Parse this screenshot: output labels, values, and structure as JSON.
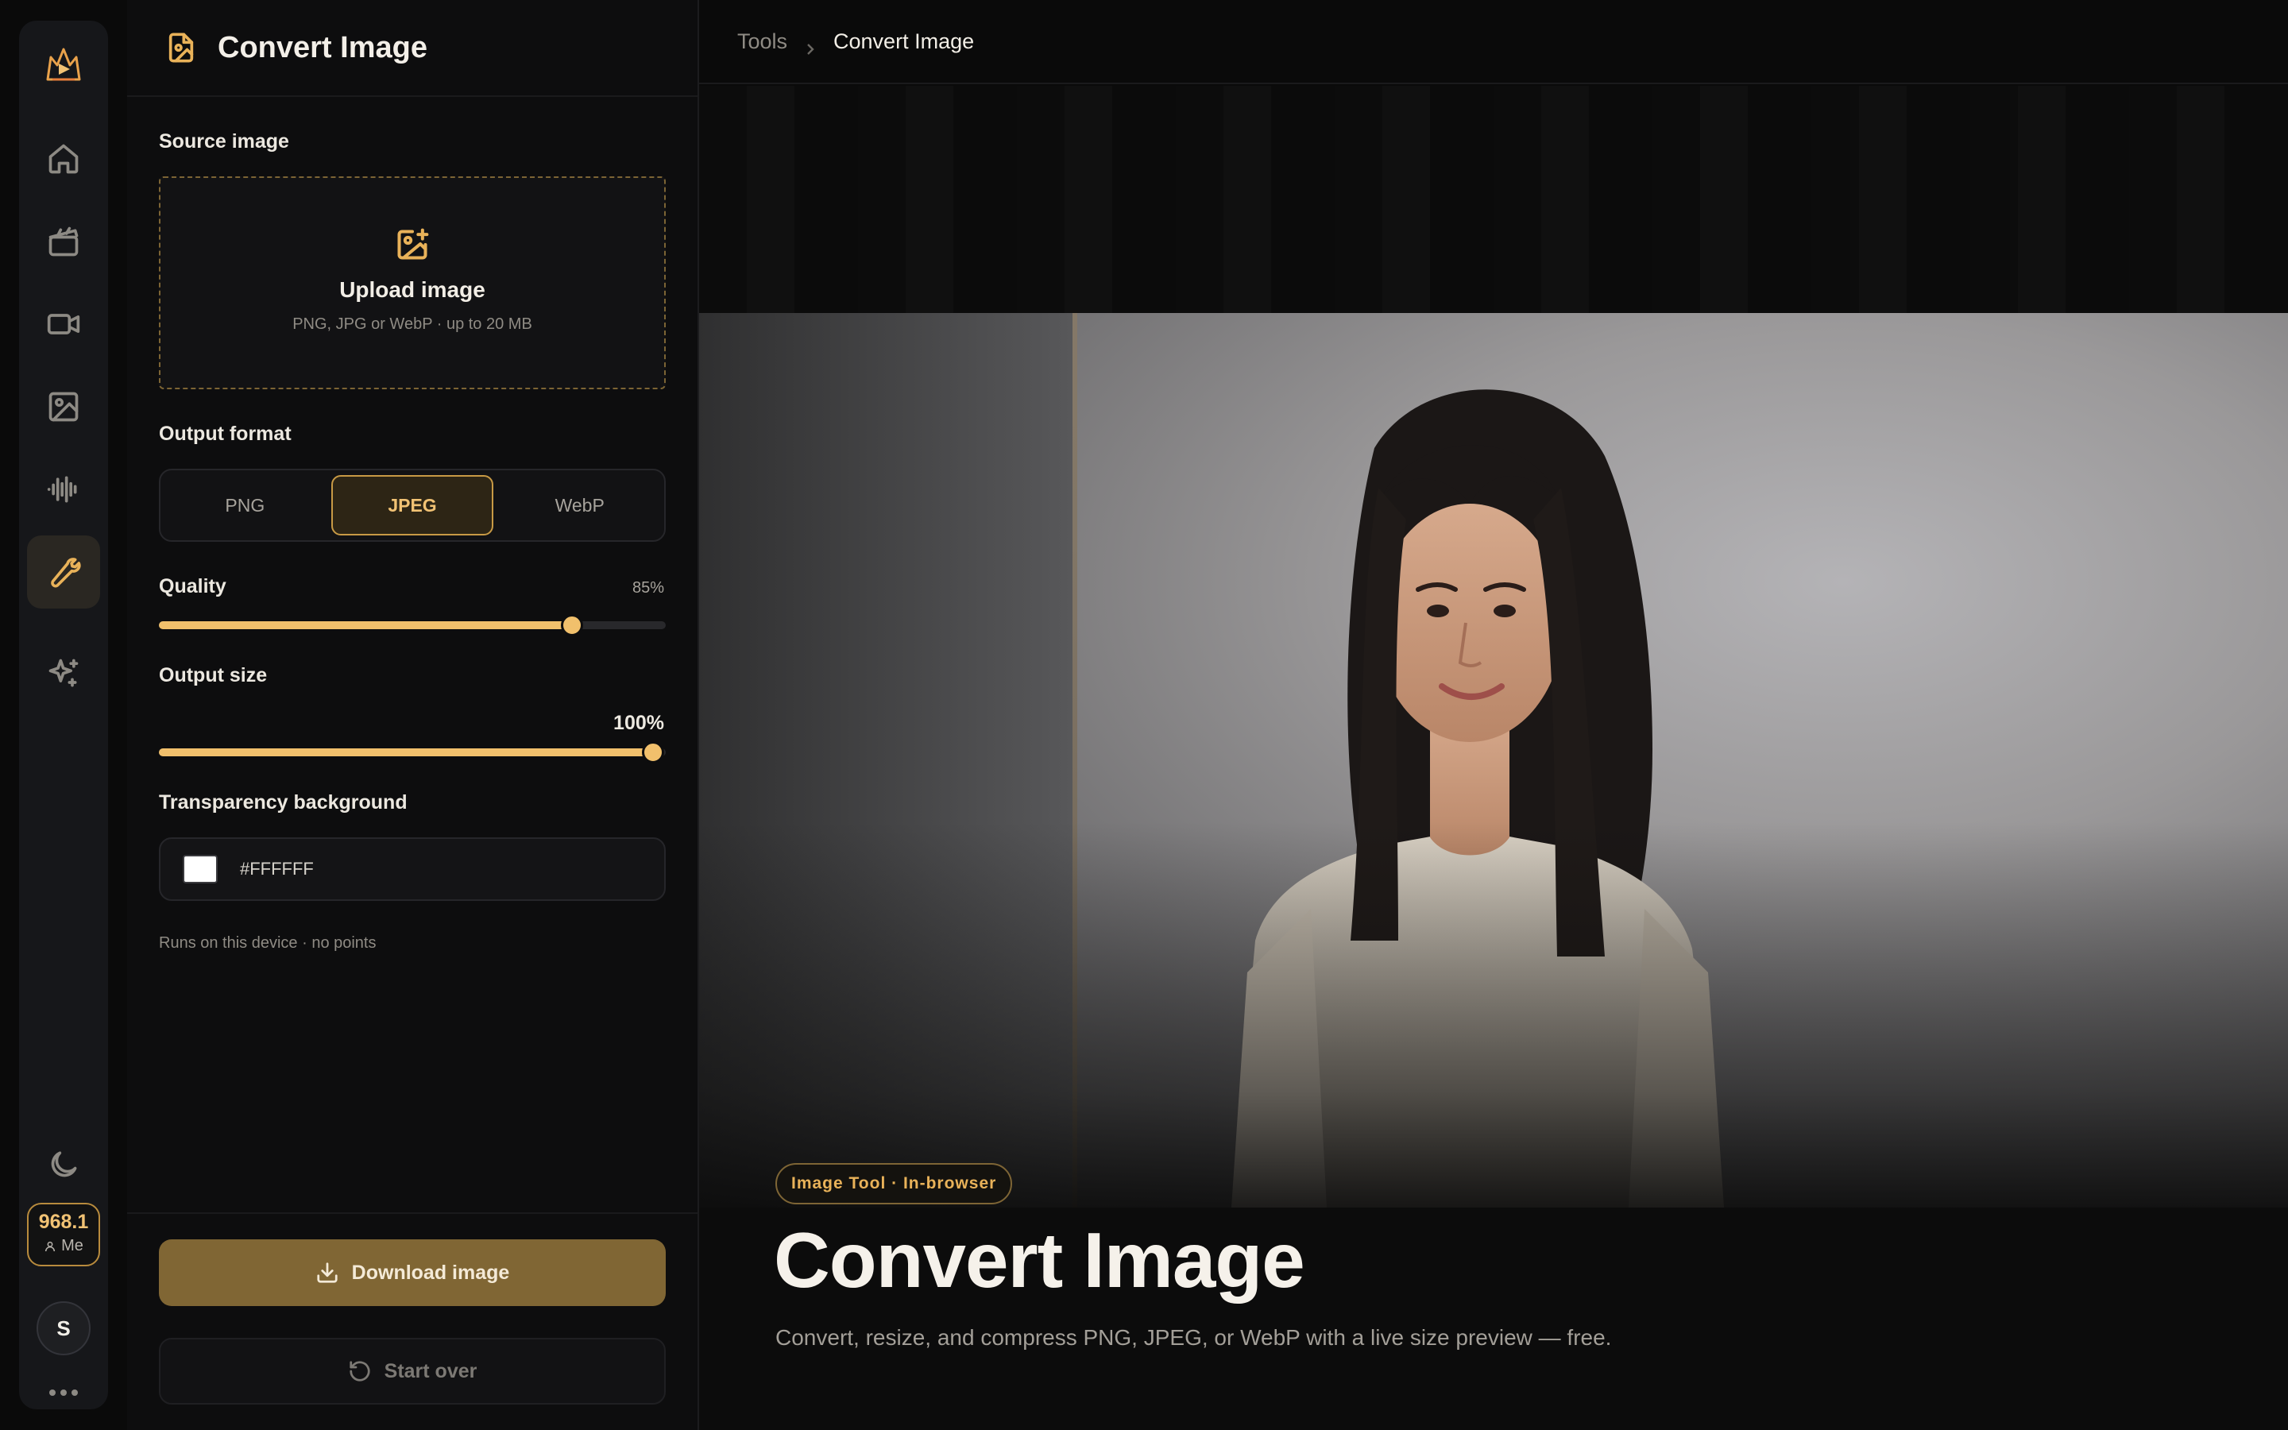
{
  "rail": {
    "credits_value": "968.1",
    "credits_label": "Me",
    "avatar_initial": "S",
    "items": [
      "home",
      "projects",
      "video",
      "image",
      "audio",
      "tools",
      "ai-effects"
    ],
    "active_item": "tools"
  },
  "panel": {
    "title": "Convert Image",
    "source_label": "Source image",
    "upload_title": "Upload image",
    "upload_hint": "PNG, JPG or WebP · up to 20 MB",
    "format_label": "Output format",
    "formats": [
      "PNG",
      "JPEG",
      "WebP"
    ],
    "selected_format": "JPEG",
    "quality_label": "Quality",
    "quality_value": "85%",
    "quality_fraction": 0.815,
    "size_label": "Output size",
    "size_value": "100%",
    "size_fraction": 0.975,
    "bg_label": "Transparency background",
    "bg_hex": "#FFFFFF",
    "note": "Runs on this device · no points",
    "download_label": "Download image",
    "start_over_label": "Start over"
  },
  "breadcrumb": {
    "root": "Tools",
    "current": "Convert Image"
  },
  "hero": {
    "badge": "Image Tool · In-browser",
    "title": "Convert Image",
    "subtitle": "Convert, resize, and compress PNG, JPEG, or WebP with a live size preview — free."
  },
  "colors": {
    "accent": "#e9b259",
    "accent_dark": "#806634",
    "bg": "#0a0a0a",
    "panel": "#0d0d0e"
  }
}
